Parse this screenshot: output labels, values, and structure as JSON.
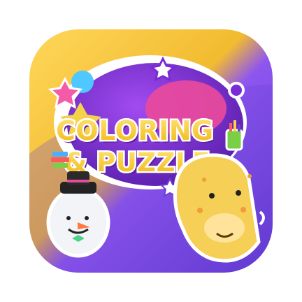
{
  "app_icon": {
    "title_line1": "COLORING",
    "title_line2": "& PUZZLE",
    "colors": {
      "frame_yellow": "#F7C733",
      "frame_purple": "#6A40D8",
      "bubble_purple": "#7B2BD6",
      "title_yellow": "#FFD33D",
      "title_shadow": "#5A1DA0",
      "pink_blob": "#E94A9C",
      "giraffe": "#F6CF57",
      "snowman": "#F2F4F8"
    },
    "icons": {
      "badge": "app-badge-icon",
      "snowman": "snowman-character-icon",
      "giraffe": "giraffe-character-icon",
      "crayons": "crayons-icon",
      "books": "book-stack-icon",
      "stars": "star-sticker-icon"
    }
  }
}
